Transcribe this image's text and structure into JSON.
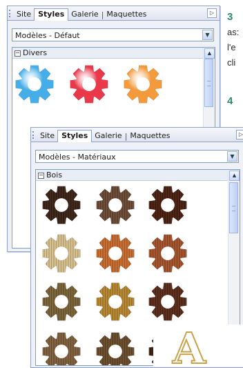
{
  "side_steps": [
    {
      "num": "3",
      "lines": [
        "as:",
        "l'e",
        "cli"
      ]
    },
    {
      "num": "4"
    }
  ],
  "back_panel": {
    "tabs": {
      "site": "Site",
      "styles": "Styles",
      "galerie": "Galerie",
      "maquettes": "Maquettes",
      "sep": "|"
    },
    "dropdown_value": "Modèles - Défaut",
    "group_label": "Divers",
    "gear_colors": [
      "#45aee8",
      "#e8384a",
      "#f39a3c"
    ]
  },
  "front_panel": {
    "tabs": {
      "site": "Site",
      "styles": "Styles",
      "galerie": "Galerie",
      "maquettes": "Maquettes",
      "sep": "|"
    },
    "dropdown_value": "Modèles - Matériaux",
    "group_label": "Bois",
    "gear_rows": [
      [
        "#3b2316",
        "#6b4a34",
        "#4a1f10"
      ],
      [
        "#d7c08c",
        "#c86b2e",
        "#a4522a"
      ],
      [
        "#7a6236",
        "#b7862f",
        "#5a2a18"
      ],
      [
        "#7f5f3c",
        "#6a4b2a",
        "#3d2010"
      ]
    ]
  },
  "letter_graphic": {
    "text": "A"
  }
}
